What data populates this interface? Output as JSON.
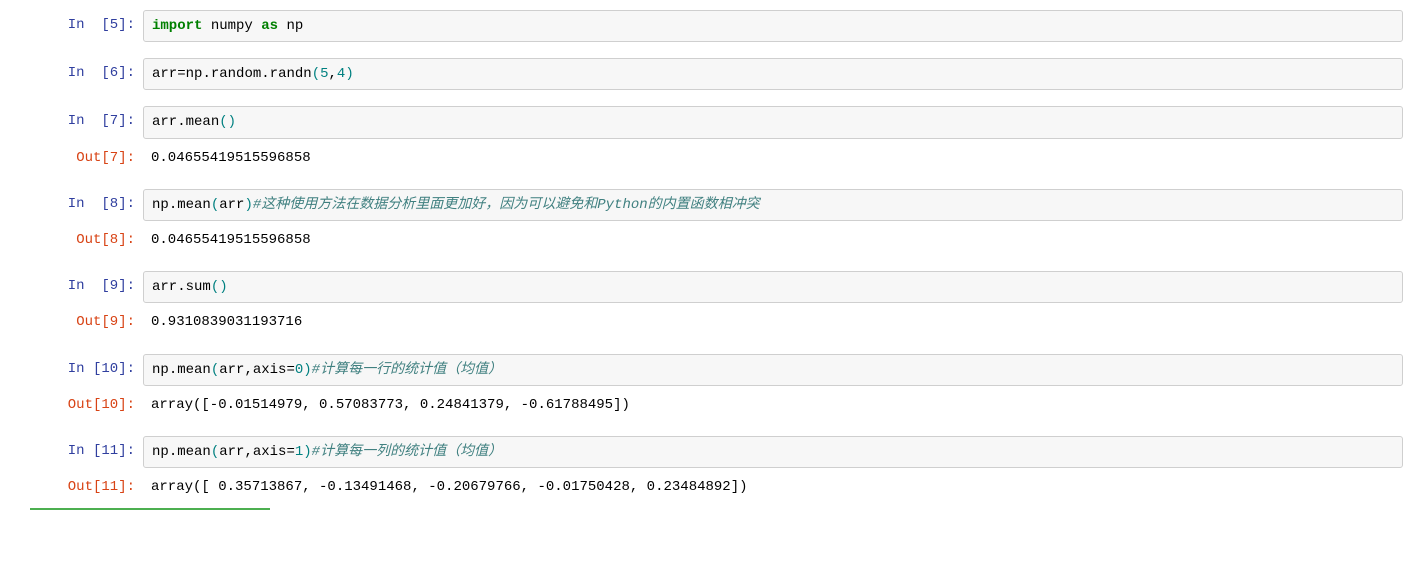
{
  "prompts": {
    "in5": "In  [5]:",
    "in6": "In  [6]:",
    "in7": "In  [7]:",
    "out7": "Out[7]:",
    "in8": "In  [8]:",
    "out8": "Out[8]:",
    "in9": "In  [9]:",
    "out9": "Out[9]:",
    "in10": "In [10]:",
    "out10": "Out[10]:",
    "in11": "In [11]:",
    "out11": "Out[11]:"
  },
  "code": {
    "c5": {
      "kw1": "import",
      "t1": " numpy ",
      "kw2": "as",
      "t2": " np"
    },
    "c6": {
      "t1": "arr",
      "eq": "=",
      "t2": "np",
      "dot1": ".",
      "t3": "random",
      "dot2": ".",
      "t4": "randn",
      "lp": "(",
      "n1": "5",
      "comma": ",",
      "n2": "4",
      "rp": ")"
    },
    "c7": {
      "t1": "arr",
      "dot": ".",
      "t2": "mean",
      "lp": "(",
      "rp": ")"
    },
    "c8": {
      "t1": "np",
      "dot": ".",
      "t2": "mean",
      "lp": "(",
      "arg": "arr",
      "rp": ")",
      "comment": "#这种使用方法在数据分析里面更加好，因为可以避免和Python的内置函数相冲突"
    },
    "c9": {
      "t1": "arr",
      "dot": ".",
      "t2": "sum",
      "lp": "(",
      "rp": ")"
    },
    "c10": {
      "t1": "np",
      "dot": ".",
      "t2": "mean",
      "lp": "(",
      "arg": "arr,axis",
      "eq": "=",
      "n": "0",
      "rp": ")",
      "comment": "#计算每一行的统计值（均值）"
    },
    "c11": {
      "t1": "np",
      "dot": ".",
      "t2": "mean",
      "lp": "(",
      "arg": "arr,axis",
      "eq": "=",
      "n": "1",
      "rp": ")",
      "comment": "#计算每一列的统计值（均值）"
    }
  },
  "outputs": {
    "o7": "0.04655419515596858",
    "o8": "0.04655419515596858",
    "o9": "0.9310839031193716",
    "o10": "array([-0.01514979,  0.57083773,  0.24841379, -0.61788495])",
    "o11": "array([ 0.35713867, -0.13491468, -0.20679766, -0.01750428,  0.23484892])"
  }
}
